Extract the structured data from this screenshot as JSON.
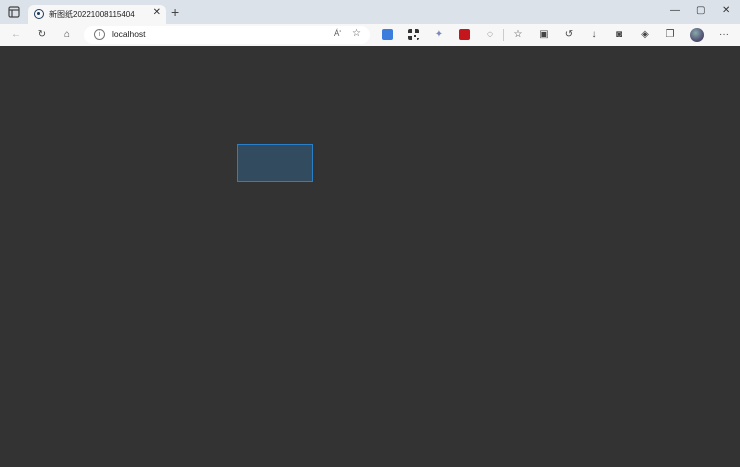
{
  "tab": {
    "title": "新图纸20221008115404",
    "close_label": "✕",
    "new_tab_label": "+"
  },
  "window_controls": {
    "minimize": "—",
    "maximize": "▢",
    "close": "✕"
  },
  "toolbar": {
    "back": "←",
    "refresh": "↻",
    "home": "⌂",
    "read_aloud": "Áʹ"
  },
  "address_bar": {
    "info_icon": "i",
    "url": "localhost"
  },
  "extensions": {
    "icons": [
      "translate-icon",
      "qr-icon",
      "puzzle-icon",
      "pdf-icon",
      "copilot-icon"
    ],
    "colors": {
      "translate": "#3b7ddd",
      "pdf": "#c4161c"
    }
  },
  "menu_label": "···",
  "canvas": {
    "background": "#333333",
    "selection_fill": "#324b5f",
    "selection_border": "#2a80c8"
  }
}
